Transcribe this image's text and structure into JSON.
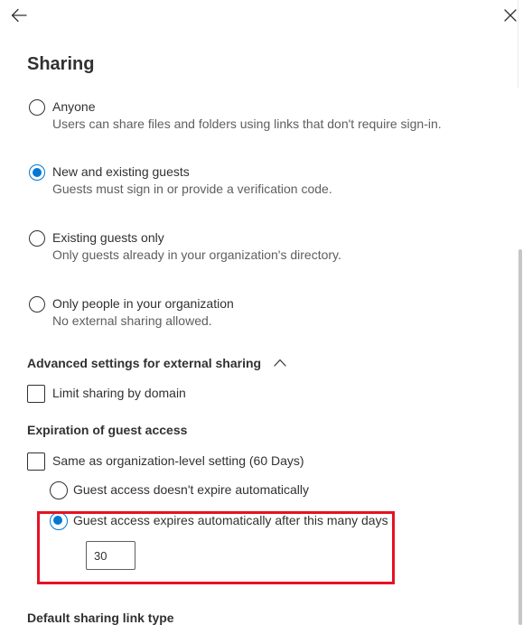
{
  "header": {
    "title": "Sharing",
    "back_icon": "arrow-left-icon",
    "close_icon": "close-icon"
  },
  "sharing_options": [
    {
      "label": "Anyone",
      "description": "Users can share files and folders using links that don't require sign-in.",
      "checked": false
    },
    {
      "label": "New and existing guests",
      "description": "Guests must sign in or provide a verification code.",
      "checked": true
    },
    {
      "label": "Existing guests only",
      "description": "Only guests already in your organization's directory.",
      "checked": false
    },
    {
      "label": "Only people in your organization",
      "description": "No external sharing allowed.",
      "checked": false
    }
  ],
  "advanced": {
    "heading": "Advanced settings for external sharing",
    "expanded": true,
    "limit_by_domain_label": "Limit sharing by domain",
    "limit_by_domain_checked": false
  },
  "expiration": {
    "heading": "Expiration of guest access",
    "same_as_org_label": "Same as organization-level setting (60 Days)",
    "same_as_org_checked": false,
    "no_expire_label": "Guest access doesn't expire automatically",
    "no_expire_checked": false,
    "expires_label": "Guest access expires automatically after this many days",
    "expires_checked": true,
    "days_value": "30"
  },
  "next_section": {
    "heading": "Default sharing link type"
  },
  "colors": {
    "accent": "#0078d4",
    "highlight": "#e81123",
    "text": "#323130",
    "secondary_text": "#605e5c"
  }
}
